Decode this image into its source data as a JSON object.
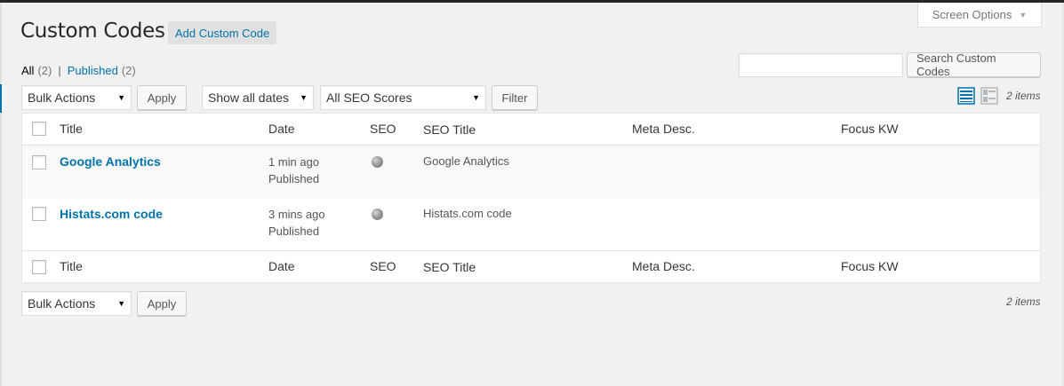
{
  "header": {
    "title": "Custom Codes",
    "add_button": "Add Custom Code",
    "screen_options": "Screen Options"
  },
  "filters": {
    "all_label": "All",
    "all_count": "(2)",
    "published_label": "Published",
    "published_count": "(2)",
    "separator": "|"
  },
  "search": {
    "value": "",
    "placeholder": "",
    "button": "Search Custom Codes"
  },
  "tablenav_top": {
    "bulk_actions": "Bulk Actions",
    "apply": "Apply",
    "dates": "Show all dates",
    "seo_scores": "All SEO Scores",
    "filter": "Filter",
    "items_count": "2 items"
  },
  "tablenav_bottom": {
    "bulk_actions": "Bulk Actions",
    "apply": "Apply",
    "items_count": "2 items"
  },
  "table": {
    "columns": [
      "Title",
      "Date",
      "SEO",
      "SEO Title",
      "Meta Desc.",
      "Focus KW"
    ],
    "rows": [
      {
        "title": "Google Analytics",
        "date": "1 min ago",
        "status": "Published",
        "seo_title": "Google Analytics",
        "meta_desc": "",
        "focus_kw": ""
      },
      {
        "title": "Histats.com code",
        "date": "3 mins ago",
        "status": "Published",
        "seo_title": "Histats.com code",
        "meta_desc": "",
        "focus_kw": ""
      }
    ]
  },
  "icons": {
    "view_list": "list-view-icon",
    "view_excerpt": "excerpt-view-icon",
    "seo_score": "seo-score-dot-icon"
  },
  "colors": {
    "link": "#0073aa",
    "background": "#f1f1f1",
    "admin_bar": "#23282d"
  }
}
